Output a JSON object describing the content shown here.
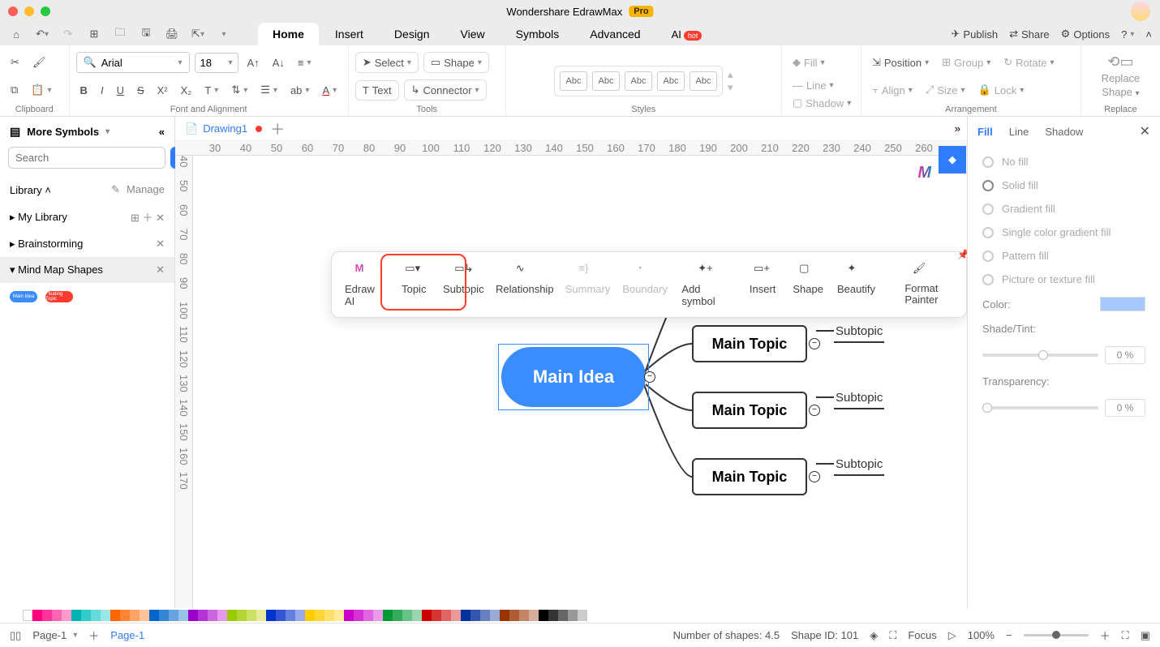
{
  "titlebar": {
    "app": "Wondershare EdrawMax",
    "badge": "Pro"
  },
  "menubar": {
    "tabs": [
      "Home",
      "Insert",
      "Design",
      "View",
      "Symbols",
      "Advanced",
      "AI"
    ],
    "active": 0,
    "hot": "hot",
    "right": {
      "publish": "Publish",
      "share": "Share",
      "options": "Options"
    }
  },
  "ribbon": {
    "clipboard": "Clipboard",
    "font": "Arial",
    "size": "18",
    "fontgroup": "Font and Alignment",
    "tools": {
      "select": "Select",
      "text": "Text",
      "shape": "Shape",
      "connector": "Connector",
      "label": "Tools"
    },
    "styles": {
      "label": "Styles",
      "abc": "Abc"
    },
    "format": {
      "fill": "Fill",
      "line": "Line",
      "shadow": "Shadow",
      "position": "Position",
      "align": "Align",
      "group": "Group",
      "size": "Size",
      "rotate": "Rotate",
      "lock": "Lock"
    },
    "arrangement": "Arrangement",
    "replace": {
      "l1": "Replace",
      "l2": "Shape",
      "label": "Replace"
    }
  },
  "sidebar": {
    "header": "More Symbols",
    "search_btn": "Search",
    "search_ph": "Search",
    "library": "Library",
    "manage": "Manage",
    "sections": [
      "My Library",
      "Brainstorming",
      "Mind Map Shapes"
    ]
  },
  "doc": {
    "name": "Drawing1"
  },
  "ruler_h": [
    "30",
    "40",
    "50",
    "60",
    "70",
    "80",
    "90",
    "100",
    "110",
    "120",
    "130",
    "140",
    "150",
    "160",
    "170",
    "180",
    "190",
    "200",
    "210",
    "220",
    "230",
    "240",
    "250",
    "260"
  ],
  "ruler_v": [
    "40",
    "50",
    "60",
    "70",
    "80",
    "90",
    "100",
    "110",
    "120",
    "130",
    "140",
    "150",
    "160",
    "170"
  ],
  "mindmap": {
    "center": "Main Idea",
    "main": "Main Topic",
    "sub": "Subtopic"
  },
  "float_toolbar": {
    "items": [
      "Edraw AI",
      "Topic",
      "Subtopic",
      "Relationship",
      "Summary",
      "Boundary",
      "Add symbol",
      "Insert",
      "Shape",
      "Beautify",
      "Format Painter"
    ]
  },
  "right_panel": {
    "tabs": [
      "Fill",
      "Line",
      "Shadow"
    ],
    "fills": [
      "No fill",
      "Solid fill",
      "Gradient fill",
      "Single color gradient fill",
      "Pattern fill",
      "Picture or texture fill"
    ],
    "color": "Color:",
    "shade": "Shade/Tint:",
    "transp": "Transparency:",
    "pct": "0 %"
  },
  "status": {
    "page": "Page-1",
    "page_active": "Page-1",
    "shapes": "Number of shapes: 4.5",
    "shapeid": "Shape ID: 101",
    "focus": "Focus",
    "zoom": "100%"
  },
  "ml": "M"
}
